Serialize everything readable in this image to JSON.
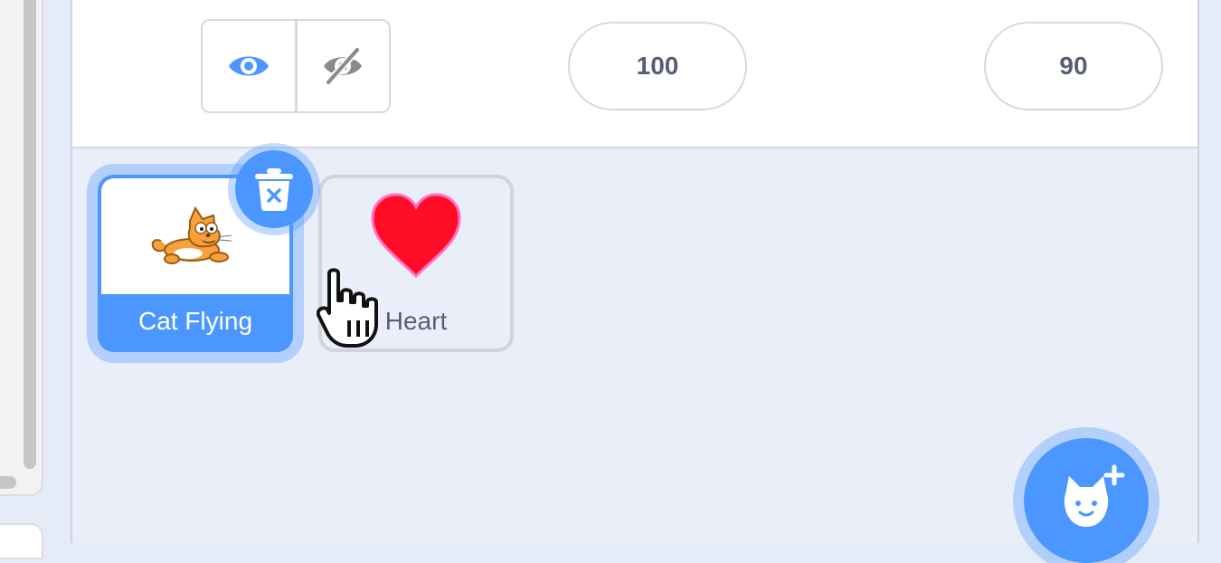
{
  "sprite_info": {
    "show_button_icon": "eye-icon",
    "hide_button_icon": "eye-slash-icon",
    "size_value": "100",
    "direction_value": "90"
  },
  "sprites": [
    {
      "name": "Cat Flying",
      "selected": true,
      "icon": "cat-flying-thumbnail"
    },
    {
      "name": "Heart",
      "selected": false,
      "icon": "heart-thumbnail"
    }
  ],
  "actions": {
    "delete_icon": "trash-icon",
    "add_sprite_icon": "cat-plus-icon"
  },
  "colors": {
    "accent": "#4c97ff",
    "text": "#575e75",
    "heart": "#ff0d26"
  }
}
